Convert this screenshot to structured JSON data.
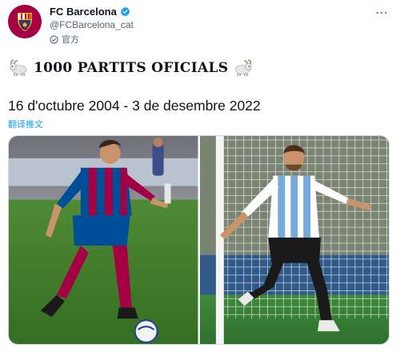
{
  "tweet": {
    "display_name": "FC Barcelona",
    "handle": "@FCBarcelona_cat",
    "official_label": "官方",
    "headline": "1000 PARTITS OFICIALS",
    "dates": "16 d'octubre 2004 - 3 de desembre 2022",
    "translate_label": "翻译推文",
    "more_icon": "⋯"
  },
  "colors": {
    "verified": "#1d9bf0",
    "link": "#1d9bf0",
    "barca_garnet": "#a50044",
    "barca_blue": "#004d98",
    "pitch_green": "#3f7d2a",
    "argentina_sky": "#75aadb"
  },
  "icons": {
    "avatar": "fcb-crest-icon",
    "verified": "verified-badge-icon",
    "official": "official-badge-icon",
    "goat": "goat-emoji-icon",
    "more": "more-options-icon"
  },
  "media": {
    "photos": [
      "barca-debut-photo",
      "argentina-celebration-photo"
    ]
  }
}
